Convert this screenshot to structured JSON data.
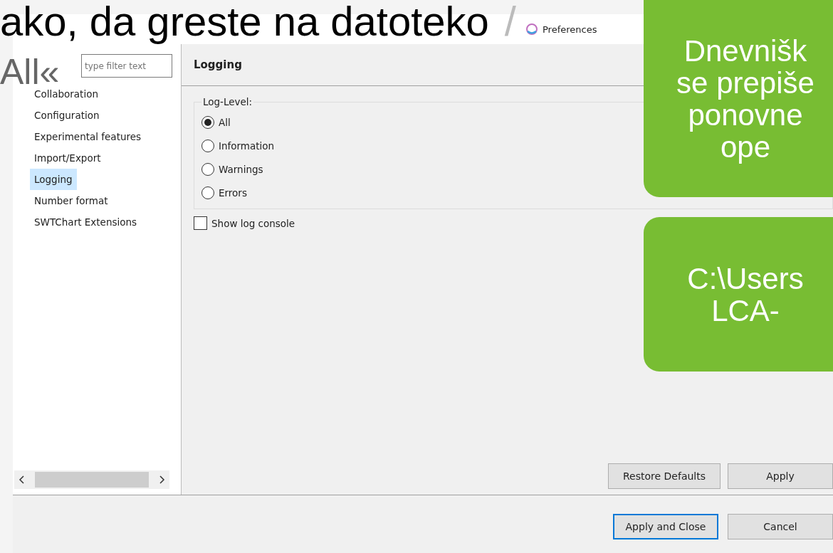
{
  "window": {
    "title": "Preferences"
  },
  "filter": {
    "placeholder": "type filter text"
  },
  "tree": [
    {
      "label": "Collaboration",
      "selected": false
    },
    {
      "label": "Configuration",
      "selected": false
    },
    {
      "label": "Experimental features",
      "selected": false
    },
    {
      "label": "Import/Export",
      "selected": false
    },
    {
      "label": "Logging",
      "selected": true
    },
    {
      "label": "Number format",
      "selected": false
    },
    {
      "label": "SWTChart Extensions",
      "selected": false
    }
  ],
  "page": {
    "title": "Logging",
    "group": "Log-Level:",
    "levels": [
      {
        "label": "All",
        "selected": true
      },
      {
        "label": "Information",
        "selected": false
      },
      {
        "label": "Warnings",
        "selected": false
      },
      {
        "label": "Errors",
        "selected": false
      }
    ],
    "console": {
      "label": "Show log console",
      "checked": false
    },
    "buttons": [
      "Restore Defaults",
      "Apply"
    ]
  },
  "dialog_buttons": [
    {
      "label": "Apply and Close",
      "default": true
    },
    {
      "label": "Cancel",
      "default": false
    }
  ],
  "slide": {
    "caption": "ako, da greste na datoteko",
    "caption_faded": "/",
    "side_note": "All«",
    "callouts": [
      {
        "lines": [
          "Dnevnišk",
          "se prepiše",
          "ponovne",
          "ope"
        ]
      },
      {
        "lines": [
          "C:\\Users",
          "LCA-"
        ]
      }
    ]
  }
}
